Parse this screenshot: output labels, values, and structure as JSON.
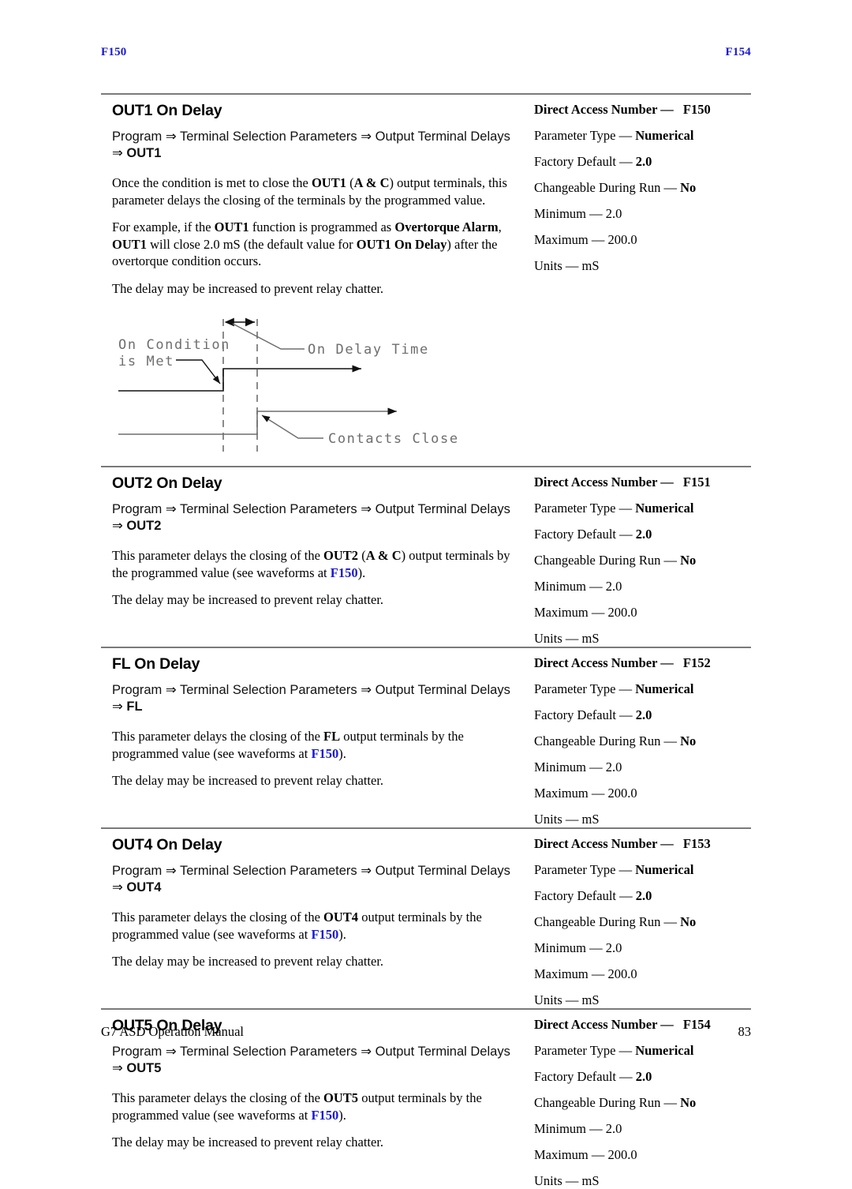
{
  "running_head": {
    "left": "F150",
    "right": "F154",
    "color": "#1a1ad0"
  },
  "footer": {
    "manual_title": "G7 ASD Operation Manual",
    "page_number": "83"
  },
  "spec_labels": {
    "direct_access": "Direct Access Number",
    "parameter_type": "Parameter Type",
    "factory_default": "Factory Default",
    "changeable": "Changeable During Run",
    "minimum": "Minimum",
    "maximum": "Maximum",
    "units": "Units",
    "dash": "—"
  },
  "sections": [
    {
      "title": "OUT1 On Delay",
      "path_line1": "Program ⇒ Terminal Selection Parameters ⇒ Output Terminal Delays",
      "path_line2_arrow": "⇒ ",
      "path_line2_target": "OUT1",
      "paragraphs": [
        {
          "parts": [
            {
              "t": "Once the condition is met to close the ",
              "s": "n"
            },
            {
              "t": "OUT1",
              "s": "b"
            },
            {
              "t": " (",
              "s": "n"
            },
            {
              "t": "A & C",
              "s": "b"
            },
            {
              "t": ") output terminals, this parameter delays the closing of the terminals by the programmed value.",
              "s": "n"
            }
          ]
        },
        {
          "parts": [
            {
              "t": "For example, if the ",
              "s": "n"
            },
            {
              "t": "OUT1",
              "s": "b"
            },
            {
              "t": " function is programmed as ",
              "s": "n"
            },
            {
              "t": "Overtorque Alarm",
              "s": "b"
            },
            {
              "t": ", ",
              "s": "n"
            },
            {
              "t": "OUT1",
              "s": "b"
            },
            {
              "t": " will close 2.0 mS (the default value for ",
              "s": "n"
            },
            {
              "t": "OUT1 On Delay",
              "s": "b"
            },
            {
              "t": ") after the overtorque condition occurs.",
              "s": "n"
            }
          ]
        },
        {
          "parts": [
            {
              "t": "The delay may be increased to prevent relay chatter.",
              "s": "n"
            }
          ]
        }
      ],
      "spec": {
        "direct_access_value": "F150",
        "parameter_type_value": "Numerical",
        "factory_default_value": "2.0",
        "changeable_value": "No",
        "minimum_value": "2.0",
        "maximum_value": "200.0",
        "units_value": "mS"
      },
      "has_diagram": true
    },
    {
      "title": "OUT2 On Delay",
      "path_line1": "Program ⇒ Terminal Selection Parameters ⇒ Output Terminal Delays",
      "path_line2_arrow": "⇒ ",
      "path_line2_target": "OUT2",
      "paragraphs": [
        {
          "parts": [
            {
              "t": "This parameter delays the closing of the ",
              "s": "n"
            },
            {
              "t": "OUT2",
              "s": "b"
            },
            {
              "t": " (",
              "s": "n"
            },
            {
              "t": "A & C",
              "s": "b"
            },
            {
              "t": ") output terminals by the programmed value (see waveforms at ",
              "s": "n"
            },
            {
              "t": "F150",
              "s": "x"
            },
            {
              "t": ").",
              "s": "n"
            }
          ]
        },
        {
          "parts": [
            {
              "t": "The delay may be increased to prevent relay chatter.",
              "s": "n"
            }
          ]
        }
      ],
      "spec": {
        "direct_access_value": "F151",
        "parameter_type_value": "Numerical",
        "factory_default_value": "2.0",
        "changeable_value": "No",
        "minimum_value": "2.0",
        "maximum_value": "200.0",
        "units_value": "mS"
      },
      "has_diagram": false
    },
    {
      "title": "FL On Delay",
      "path_line1": "Program ⇒ Terminal Selection Parameters ⇒ Output Terminal Delays",
      "path_line2_arrow": "⇒ ",
      "path_line2_target": "FL",
      "paragraphs": [
        {
          "parts": [
            {
              "t": "This parameter delays the closing of the ",
              "s": "n"
            },
            {
              "t": "FL",
              "s": "b"
            },
            {
              "t": " output terminals by the programmed value (see waveforms at ",
              "s": "n"
            },
            {
              "t": "F150",
              "s": "x"
            },
            {
              "t": ").",
              "s": "n"
            }
          ]
        },
        {
          "parts": [
            {
              "t": "The delay may be increased to prevent relay chatter.",
              "s": "n"
            }
          ]
        }
      ],
      "spec": {
        "direct_access_value": "F152",
        "parameter_type_value": "Numerical",
        "factory_default_value": "2.0",
        "changeable_value": "No",
        "minimum_value": "2.0",
        "maximum_value": "200.0",
        "units_value": "mS"
      },
      "has_diagram": false
    },
    {
      "title": "OUT4 On Delay",
      "path_line1": "Program ⇒ Terminal Selection Parameters ⇒ Output Terminal Delays",
      "path_line2_arrow": "⇒ ",
      "path_line2_target": "OUT4",
      "paragraphs": [
        {
          "parts": [
            {
              "t": "This parameter delays the closing of the ",
              "s": "n"
            },
            {
              "t": "OUT4",
              "s": "b"
            },
            {
              "t": " output terminals by the programmed value (see waveforms at ",
              "s": "n"
            },
            {
              "t": "F150",
              "s": "x"
            },
            {
              "t": ").",
              "s": "n"
            }
          ]
        },
        {
          "parts": [
            {
              "t": "The delay may be increased to prevent relay chatter.",
              "s": "n"
            }
          ]
        }
      ],
      "spec": {
        "direct_access_value": "F153",
        "parameter_type_value": "Numerical",
        "factory_default_value": "2.0",
        "changeable_value": "No",
        "minimum_value": "2.0",
        "maximum_value": "200.0",
        "units_value": "mS"
      },
      "has_diagram": false
    },
    {
      "title": "OUT5 On Delay",
      "path_line1": "Program ⇒ Terminal Selection Parameters ⇒ Output Terminal Delays",
      "path_line2_arrow": "⇒ ",
      "path_line2_target": "OUT5",
      "paragraphs": [
        {
          "parts": [
            {
              "t": "This parameter delays the closing of the ",
              "s": "n"
            },
            {
              "t": "OUT5",
              "s": "b"
            },
            {
              "t": " output terminals by the programmed value (see waveforms at ",
              "s": "n"
            },
            {
              "t": "F150",
              "s": "x"
            },
            {
              "t": ").",
              "s": "n"
            }
          ]
        },
        {
          "parts": [
            {
              "t": "The delay may be increased to prevent relay chatter.",
              "s": "n"
            }
          ]
        }
      ],
      "spec": {
        "direct_access_value": "F154",
        "parameter_type_value": "Numerical",
        "factory_default_value": "2.0",
        "changeable_value": "No",
        "minimum_value": "2.0",
        "maximum_value": "200.0",
        "units_value": "mS"
      },
      "has_diagram": false
    }
  ],
  "diagram": {
    "label_on_condition_line1": "On Condition",
    "label_on_condition_line2": "is Met",
    "label_on_delay_time": "On Delay Time",
    "label_contacts_close": "Contacts Close",
    "line_color": "#6e6e6e",
    "arrow_color": "#111111"
  }
}
